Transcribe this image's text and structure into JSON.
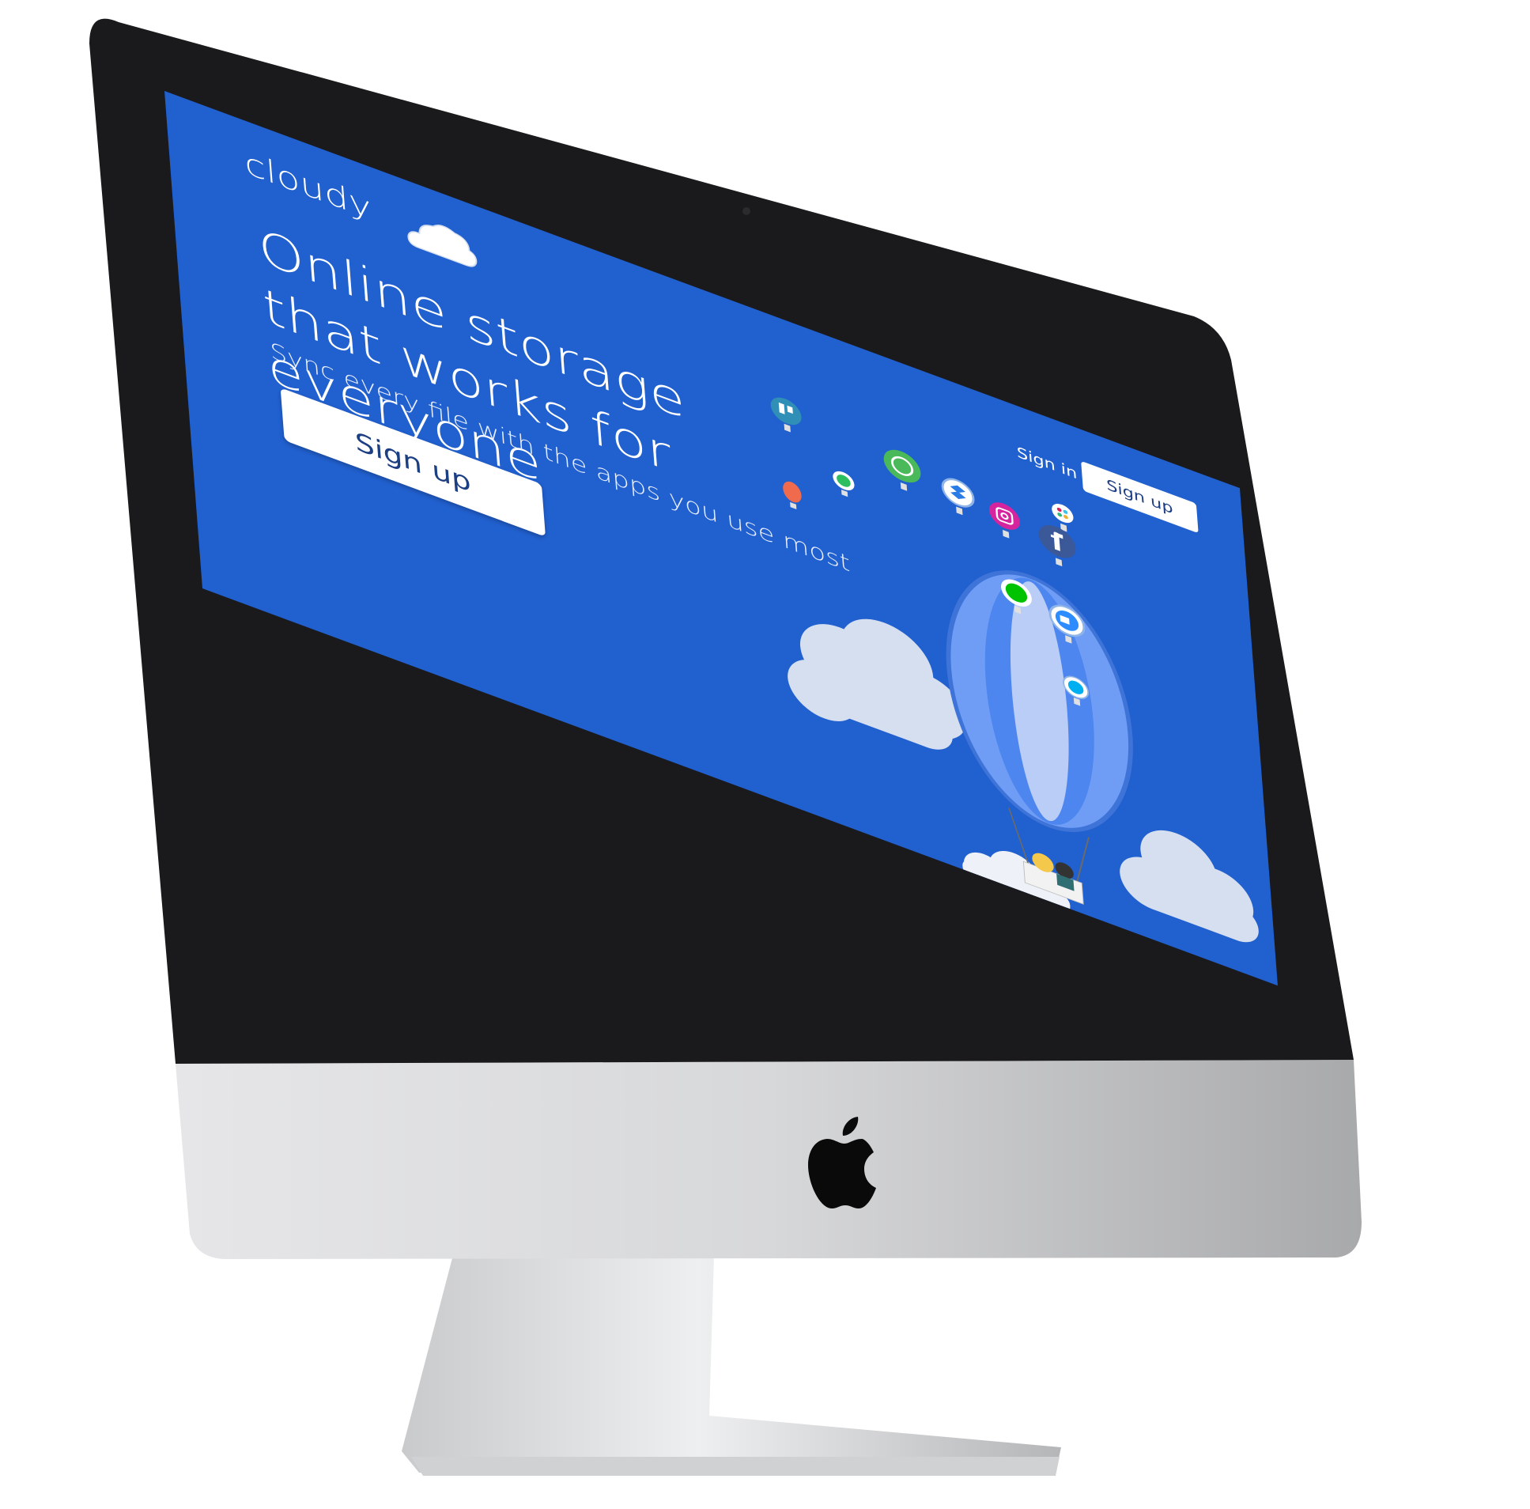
{
  "brand": {
    "name": "cloudy"
  },
  "hero": {
    "title": "Online storage that works for everyone",
    "subtitle": "Sync every file with the apps you use most",
    "cta_label": "Sign up"
  },
  "nav": {
    "signin_label": "Sign in",
    "signup_label": "Sign up"
  },
  "colors": {
    "page_background": "#2160cf",
    "button_text": "#1c3e83",
    "balloon": "#6f9df6",
    "cloud": "#d6dff0"
  },
  "illustration": {
    "app_balloons": [
      "trello-icon",
      "slack-icon",
      "whatsapp-icon",
      "dropbox-icon",
      "instagram-icon",
      "facebook-icon",
      "evernote-icon",
      "generic-red-balloon-icon",
      "line-icon",
      "zoom-icon",
      "skype-icon"
    ]
  },
  "device": {
    "logo": "apple-logo-icon"
  }
}
